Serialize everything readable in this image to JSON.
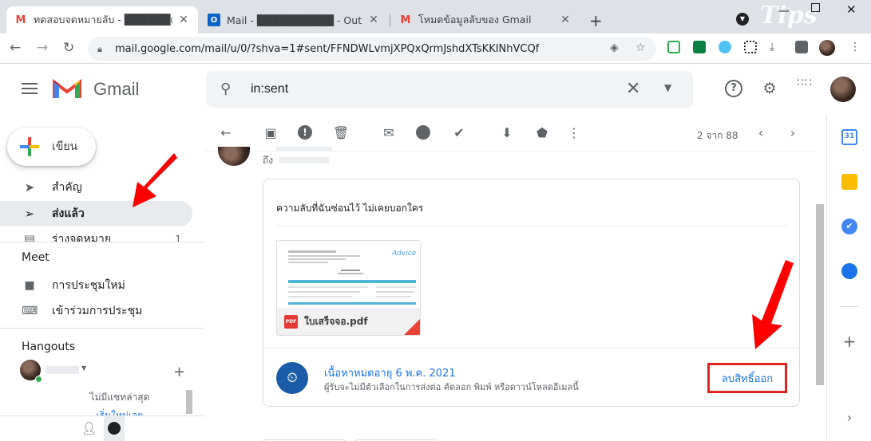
{
  "browser": {
    "tabs": [
      {
        "title": "ทดสอบจดหมายลับ - ██████@gm",
        "favicon": "gmail-icon",
        "active": true
      },
      {
        "title": "Mail - ██████████ - Outlook",
        "favicon": "outlook-icon",
        "active": false
      },
      {
        "title": "โหมดข้อมูลลับของ Gmail",
        "favicon": "gmail-icon",
        "active": false
      }
    ],
    "new_tab": "+",
    "url": "mail.google.com/mail/u/0/?shva=1#sent/FFNDWLvmjXPQxQrmJshdXTsKKINhVCQf",
    "watermark": "Tips"
  },
  "gmail": {
    "brand": "Gmail",
    "search_value": "in:sent",
    "compose_label": "เขียน",
    "nav": [
      {
        "label": "สำคัญ",
        "icon": "label-important-icon"
      },
      {
        "label": "ส่งแล้ว",
        "icon": "send-icon",
        "selected": true
      },
      {
        "label": "ร่างจดหมาย",
        "icon": "draft-icon",
        "count": "1"
      }
    ],
    "meet": {
      "title": "Meet",
      "new_meeting": "การประชุมใหม่",
      "join_meeting": "เข้าร่วมการประชุม"
    },
    "hangouts": {
      "title": "Hangouts",
      "no_chats": "ไม่มีแชทล่าสุด",
      "start_new": "เริ่มใหม่เลย"
    },
    "toolbar": {
      "pager": "2 จาก 88"
    },
    "message": {
      "to_prefix": "ถึง",
      "body": "ความลับที่ฉันซ่อนไว้ ไม่เคยบอกใคร",
      "attachment_name": "ใบเสร็จจอ.pdf",
      "attachment_type": "PDF",
      "doc_brand": "Advice",
      "expire_title": "เนื้อหาหมดอายุ 6 พ.ค. 2021",
      "expire_subtitle": "ผู้รับจะไม่มีตัวเลือกในการส่งต่อ คัดลอก พิมพ์ หรือดาวน์โหลดอีเมลนี้",
      "revoke_label": "ลบสิทธิ์ออก"
    }
  },
  "colors": {
    "accent_blue": "#1a73e8",
    "highlight_red": "#e02424",
    "selected_nav_bg": "#e8eaed",
    "expire_icon_bg": "#1a5ca8"
  }
}
